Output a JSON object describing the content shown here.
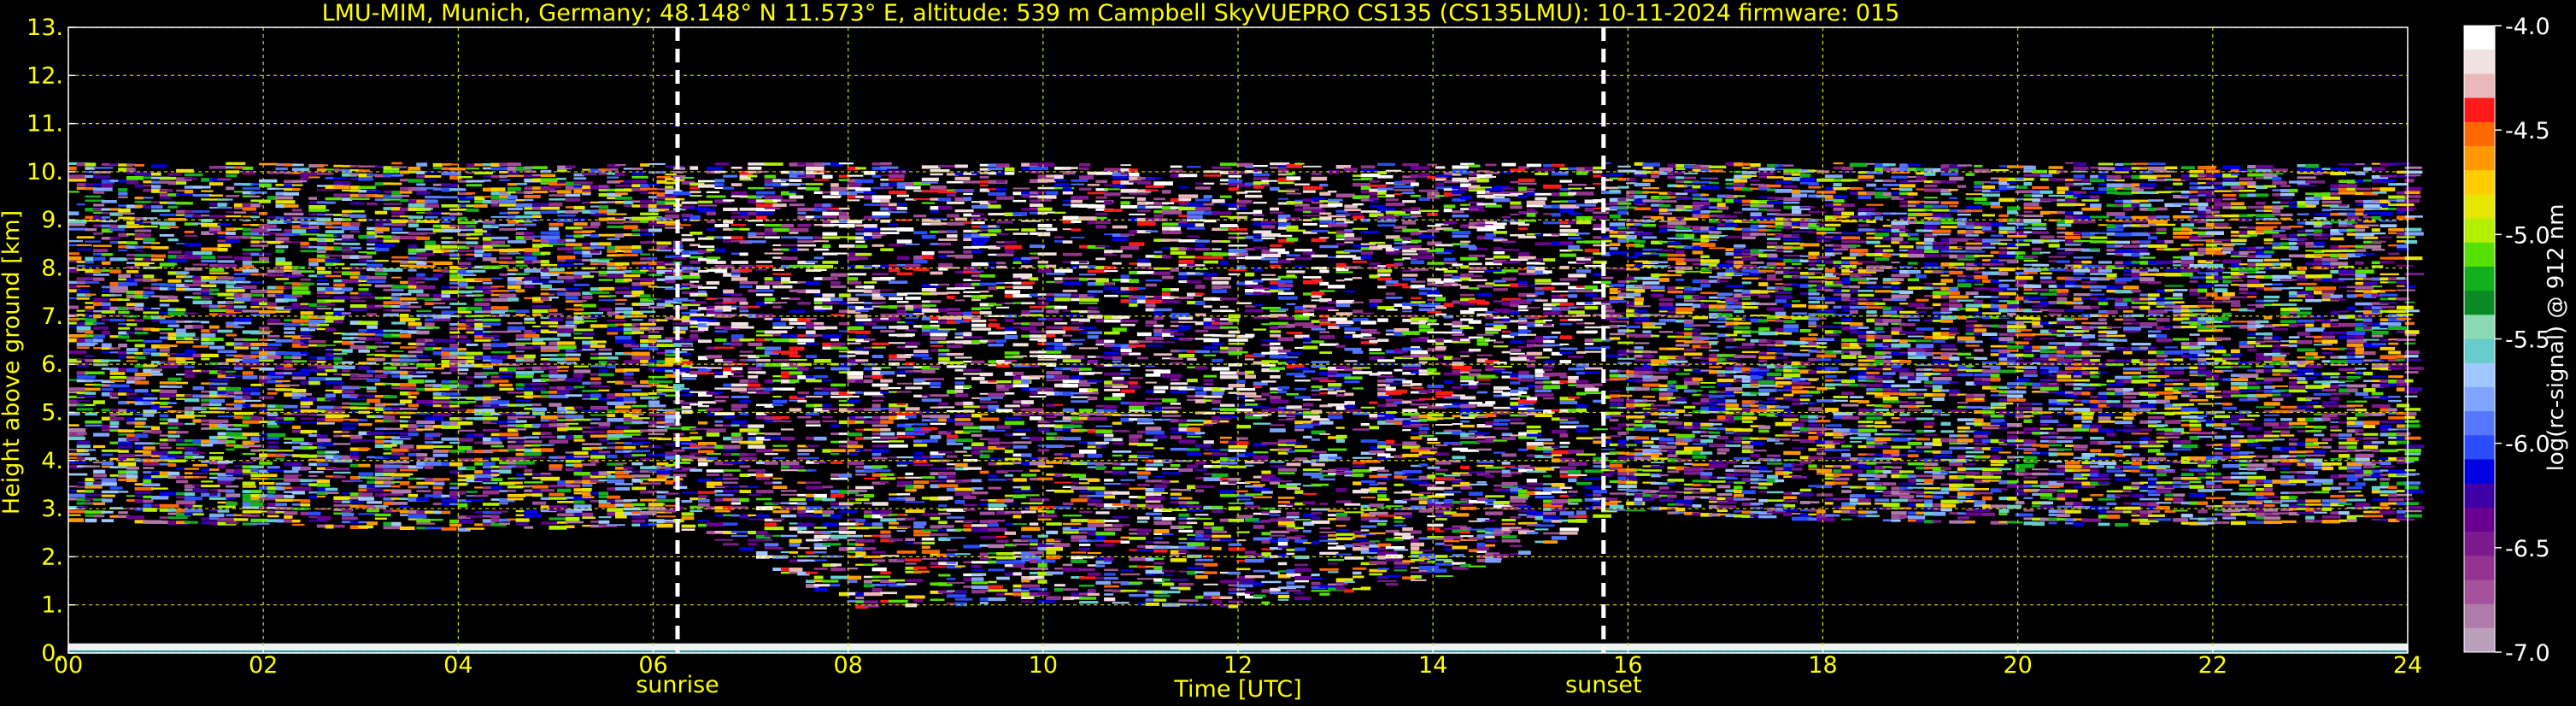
{
  "chart_data": {
    "type": "heatmap",
    "title": "LMU-MIM, Munich, Germany; 48.148° N 11.573° E, altitude: 539 m    Campbell SkyVUEPRO CS135 (CS135LMU): 10-11-2024    firmware: 015",
    "xlabel": "Time [UTC]",
    "ylabel": "Height above ground [km]",
    "xlim": [
      0,
      24
    ],
    "ylim": [
      0,
      13
    ],
    "x_ticks": [
      0,
      2,
      4,
      6,
      8,
      10,
      12,
      14,
      16,
      18,
      20,
      22,
      24
    ],
    "x_tick_labels": [
      "00",
      "02",
      "04",
      "06",
      "08",
      "10",
      "12",
      "14",
      "16",
      "18",
      "20",
      "22",
      "24"
    ],
    "y_ticks": [
      0,
      1,
      2,
      3,
      4,
      5,
      6,
      7,
      8,
      9,
      10,
      11,
      12,
      13
    ],
    "y_tick_labels": [
      "0.",
      "1.",
      "2.",
      "3.",
      "4.",
      "5.",
      "6.",
      "7.",
      "8.",
      "9.",
      "10.",
      "11.",
      "12.",
      "13."
    ],
    "grid": true,
    "markers": [
      {
        "label": "sunrise",
        "time": 6.25
      },
      {
        "label": "sunset",
        "time": 15.75
      }
    ],
    "signal_top_km": 10.2,
    "signal_base_km": [
      {
        "time": 0,
        "km": 2.8
      },
      {
        "time": 2,
        "km": 2.7
      },
      {
        "time": 4,
        "km": 2.6
      },
      {
        "time": 6,
        "km": 2.7
      },
      {
        "time": 6.5,
        "km": 2.5
      },
      {
        "time": 7,
        "km": 2.0
      },
      {
        "time": 8,
        "km": 1.0
      },
      {
        "time": 10,
        "km": 1.1
      },
      {
        "time": 12,
        "km": 1.0
      },
      {
        "time": 13,
        "km": 1.3
      },
      {
        "time": 14,
        "km": 1.6
      },
      {
        "time": 15,
        "km": 2.2
      },
      {
        "time": 15.75,
        "km": 3.0
      },
      {
        "time": 18,
        "km": 2.8
      },
      {
        "time": 21,
        "km": 2.7
      },
      {
        "time": 24,
        "km": 2.8
      }
    ],
    "colorbar": {
      "label": "log(rc-signal) @ 912 nm",
      "min": -7.0,
      "max": -4.0,
      "ticks": [
        -4.0,
        -4.5,
        -5.0,
        -5.5,
        -6.0,
        -6.5,
        -7.0
      ],
      "tick_labels": [
        "-4.0",
        "-4.5",
        "-5.0",
        "-5.5",
        "-6.0",
        "-6.5",
        "-7.0"
      ],
      "colors": [
        "#ffffff",
        "#f2e2e2",
        "#e9b8b8",
        "#ff1a1a",
        "#ff6a00",
        "#ff9900",
        "#ffcc00",
        "#e6e600",
        "#b3f000",
        "#55e000",
        "#12b01e",
        "#0a8a22",
        "#8cd9b3",
        "#66cccc",
        "#9ec8ff",
        "#7fa6ff",
        "#5577ff",
        "#2a4dff",
        "#0000e0",
        "#3d00a6",
        "#6a0090",
        "#7b1a8c",
        "#93328f",
        "#a4539b",
        "#b07aaa",
        "#bba0bb"
      ]
    }
  }
}
